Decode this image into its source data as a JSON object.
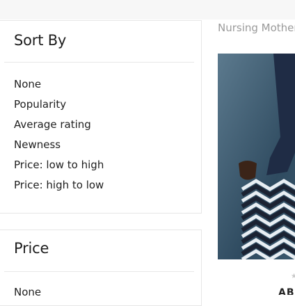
{
  "sort_panel": {
    "title": "Sort By",
    "options": [
      "None",
      "Popularity",
      "Average rating",
      "Newness",
      "Price: low to high",
      "Price: high to low"
    ]
  },
  "price_panel": {
    "title": "Price",
    "options": [
      "None"
    ]
  },
  "product": {
    "category": "Nursing Mother",
    "title_fragment": "ABI",
    "rating_icon": "star-icon"
  },
  "colors": {
    "background_band": "#f7f7f7",
    "muted_text": "#9a9a9a"
  }
}
